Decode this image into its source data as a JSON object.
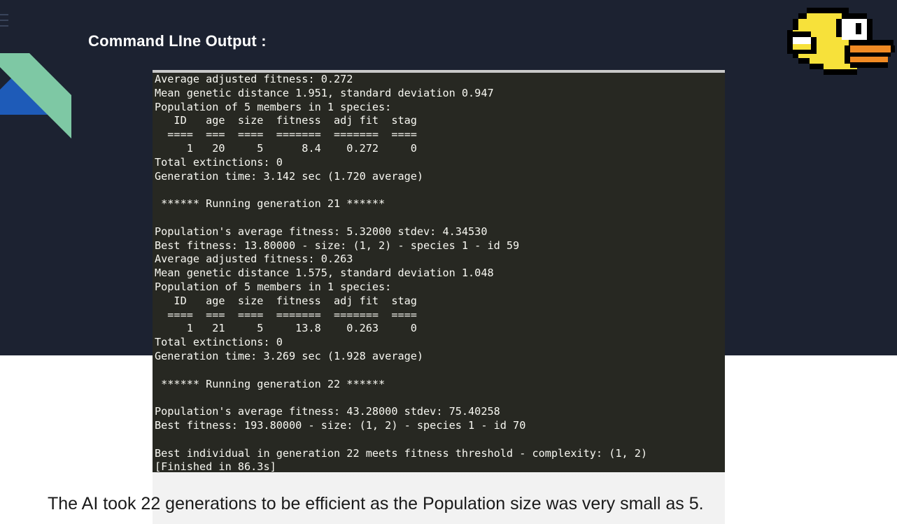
{
  "heading": "Command LIne Output :",
  "terminal": {
    "lines": [
      "Average adjusted fitness: 0.272",
      "Mean genetic distance 1.951, standard deviation 0.947",
      "Population of 5 members in 1 species:",
      "   ID   age  size  fitness  adj fit  stag",
      "  ====  ===  ====  =======  =======  ====",
      "     1   20     5      8.4    0.272     0",
      "Total extinctions: 0",
      "Generation time: 3.142 sec (1.720 average)",
      "",
      " ****** Running generation 21 ******",
      "",
      "Population's average fitness: 5.32000 stdev: 4.34530",
      "Best fitness: 13.80000 - size: (1, 2) - species 1 - id 59",
      "Average adjusted fitness: 0.263",
      "Mean genetic distance 1.575, standard deviation 1.048",
      "Population of 5 members in 1 species:",
      "   ID   age  size  fitness  adj fit  stag",
      "  ====  ===  ====  =======  =======  ====",
      "     1   21     5     13.8    0.263     0",
      "Total extinctions: 0",
      "Generation time: 3.269 sec (1.928 average)",
      "",
      " ****** Running generation 22 ******",
      "",
      "Population's average fitness: 43.28000 stdev: 75.40258",
      "Best fitness: 193.80000 - size: (1, 2) - species 1 - id 70",
      "",
      "Best individual in generation 22 meets fitness threshold - complexity: (1, 2)",
      "[Finished in 86.3s]"
    ]
  },
  "caption": "The AI took 22 generations to be efficient as the Population  size was very small as 5.",
  "colors": {
    "slide_background": "#1c2231",
    "terminal_background": "#272822",
    "terminal_text": "#f8f8f2",
    "accent_green": "#7ec8a4",
    "accent_blue": "#1e5bb8",
    "bird_yellow": "#f7e13a",
    "bird_beak": "#f08a24"
  },
  "icons": [
    "menu-icon",
    "flappy-bird-icon"
  ]
}
